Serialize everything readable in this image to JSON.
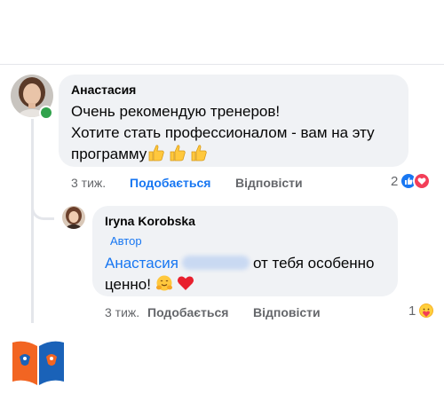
{
  "comment": {
    "author": "Анастасия",
    "line1": "Очень рекомендую тренеров!",
    "line2": "Хотите стать профессионалом - вам на эту",
    "line3": "программу",
    "time": "3 тиж.",
    "like_label": "Подобається",
    "reply_label": "Відповісти",
    "reaction_count": "2",
    "reactions": [
      "like-icon",
      "love-icon"
    ],
    "emoji": "thumbs-up x3"
  },
  "reply": {
    "author": "Iryna  Korobska",
    "badge": "Автор",
    "mention": "Анастасия",
    "text_after_mention": "от тебя особенно",
    "line2": "ценно!",
    "emoji": [
      "hugging-face",
      "red-heart"
    ],
    "time": "3 тиж.",
    "like_label": "Подобається",
    "reply_label": "Відповісти",
    "reaction_count": "1",
    "reactions": [
      "care-icon"
    ]
  },
  "colors": {
    "link_blue": "#1877f2",
    "bubble_bg": "#f0f2f5",
    "secondary_text": "#65676b",
    "online_green": "#31a24c",
    "love_red": "#f33e58",
    "logo_blue": "#1a62b8",
    "logo_orange": "#f26522"
  }
}
